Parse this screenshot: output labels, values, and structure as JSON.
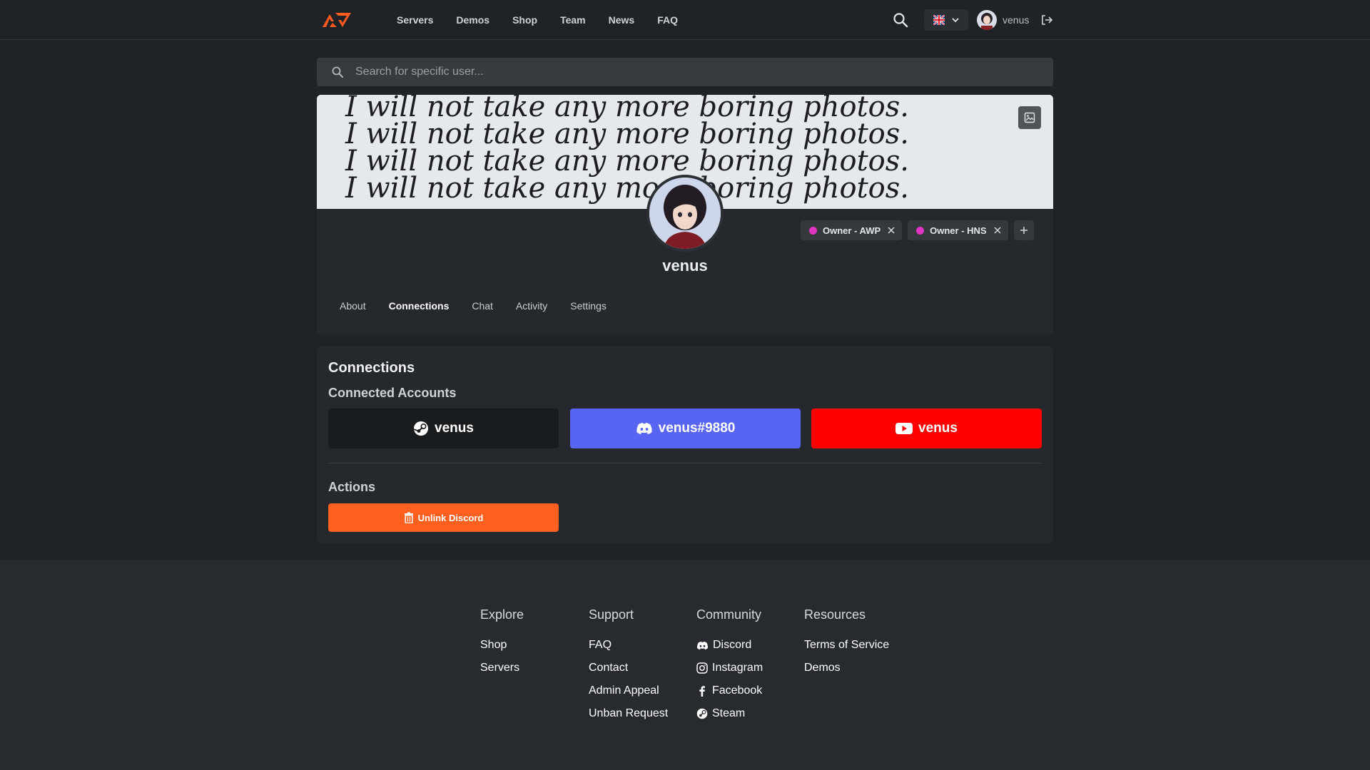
{
  "nav": {
    "links": [
      "Servers",
      "Demos",
      "Shop",
      "Team",
      "News",
      "FAQ"
    ],
    "user": "venus"
  },
  "search": {
    "placeholder": "Search for specific user..."
  },
  "profile": {
    "username": "venus",
    "roles": [
      {
        "label": "Owner - AWP",
        "color": "#e234c2"
      },
      {
        "label": "Owner - HNS",
        "color": "#e234c2"
      }
    ],
    "tabs": [
      "About",
      "Connections",
      "Chat",
      "Activity",
      "Settings"
    ],
    "active_tab": "Connections",
    "banner_text": [
      "I will not take any more boring photos.",
      "I will not take any more boring photos.",
      "I will not take any more boring photos.",
      "I will not take any more boring photos."
    ]
  },
  "connections": {
    "title": "Connections",
    "subtitle": "Connected Accounts",
    "accounts": [
      {
        "service": "steam",
        "label": "venus",
        "color": "#191c1f"
      },
      {
        "service": "discord",
        "label": "venus#9880",
        "color": "#5865f2"
      },
      {
        "service": "youtube",
        "label": "venus",
        "color": "#ff0000"
      }
    ],
    "actions_title": "Actions",
    "unlink_label": "Unlink Discord",
    "unlink_color": "#ff5f1f"
  },
  "footer": {
    "explore": {
      "title": "Explore",
      "links": [
        "Shop",
        "Servers"
      ]
    },
    "support": {
      "title": "Support",
      "links": [
        "FAQ",
        "Contact",
        "Admin Appeal",
        "Unban Request"
      ]
    },
    "community": {
      "title": "Community",
      "links": [
        "Discord",
        "Instagram",
        "Facebook",
        "Steam"
      ]
    },
    "resources": {
      "title": "Resources",
      "links": [
        "Terms of Service",
        "Demos"
      ]
    }
  }
}
